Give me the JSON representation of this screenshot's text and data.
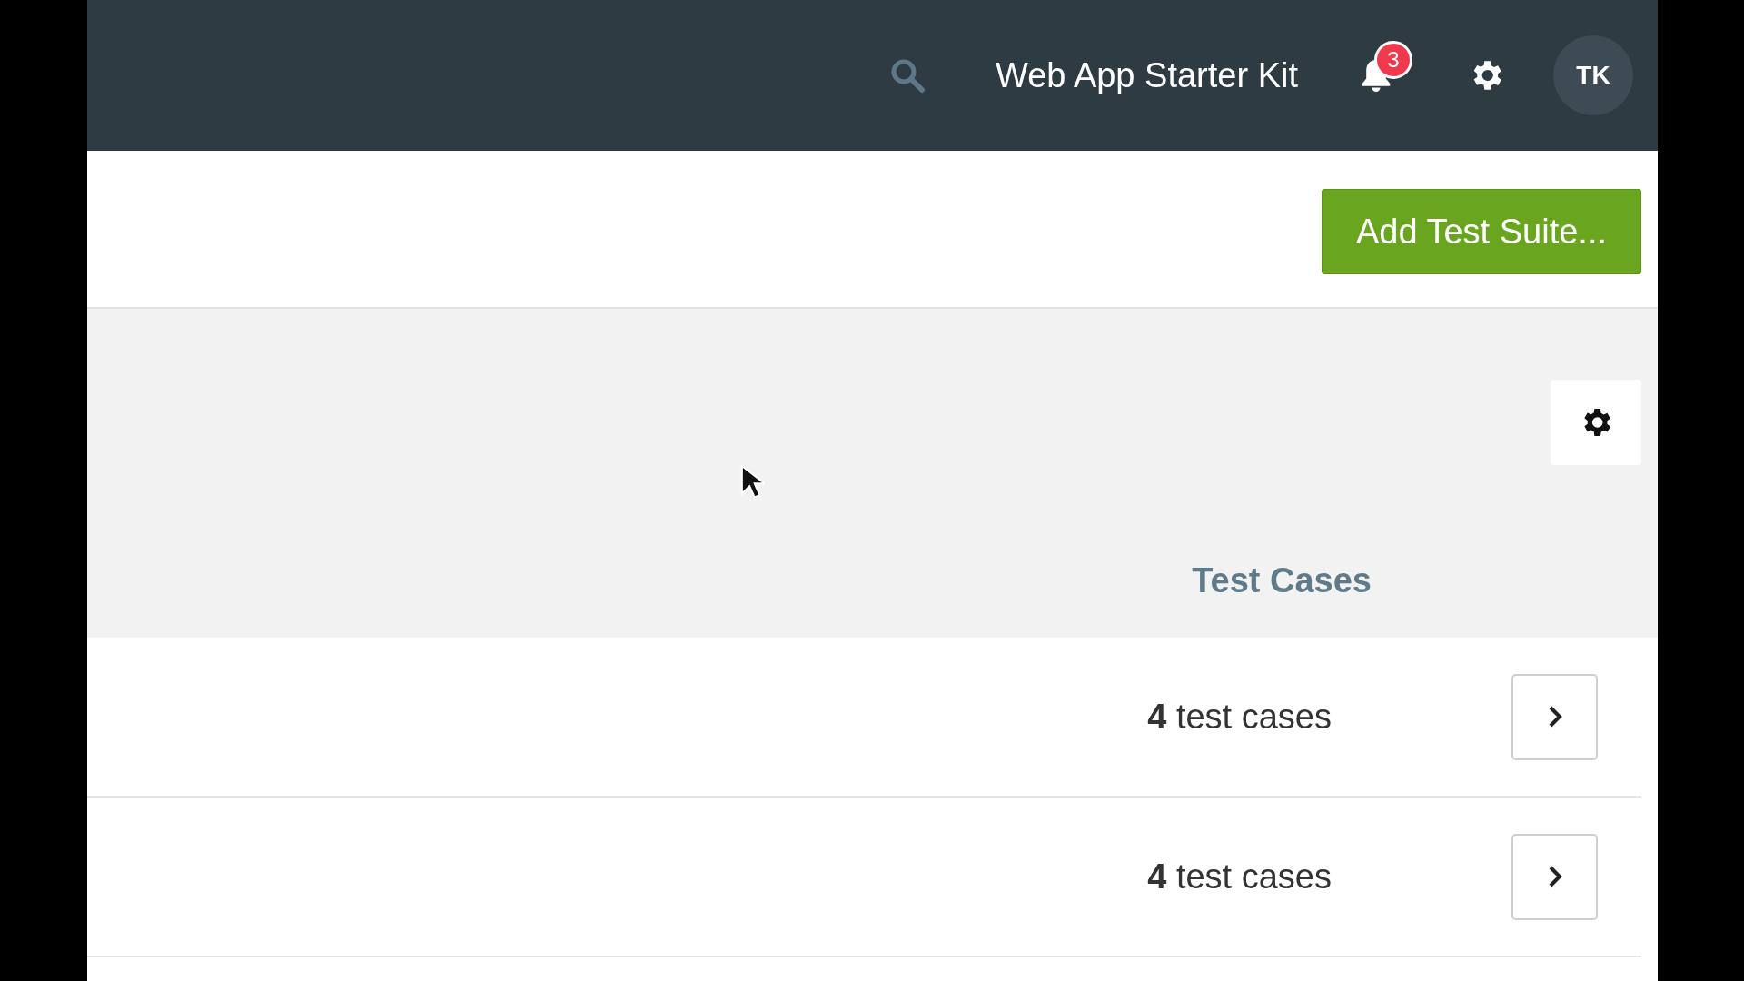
{
  "header": {
    "title": "Web App Starter Kit",
    "notification_count": "3",
    "avatar_initials": "TK"
  },
  "toolbar": {
    "add_button": "Add Test Suite..."
  },
  "table": {
    "columns": [
      {
        "label": "Test Cases"
      }
    ],
    "rows": [
      {
        "test_cases": "**4** test cases"
      },
      {
        "test_cases": "**4** test cases"
      }
    ]
  }
}
